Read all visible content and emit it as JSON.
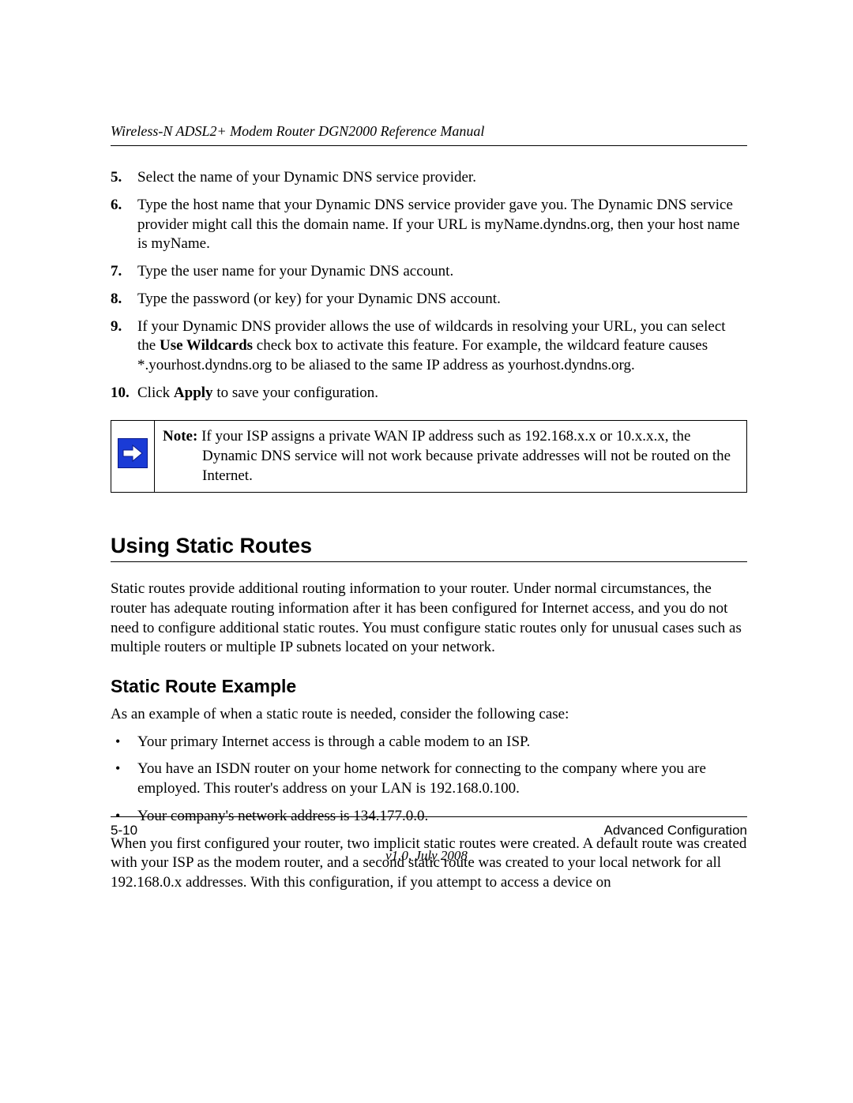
{
  "header": {
    "running_title": "Wireless-N ADSL2+ Modem Router DGN2000 Reference Manual"
  },
  "steps": {
    "s5": "Select the name of your Dynamic DNS service provider.",
    "s6": "Type the host name that your Dynamic DNS service provider gave you. The Dynamic DNS service provider might call this the domain name. If your URL is myName.dyndns.org, then your host name is myName.",
    "s7": "Type the user name for your Dynamic DNS account.",
    "s8": "Type the password (or key) for your Dynamic DNS account.",
    "s9_a": "If your Dynamic DNS provider allows the use of wildcards in resolving your URL, you can select the ",
    "s9_bold": "Use Wildcards",
    "s9_b": " check box to activate this feature. For example, the wildcard feature causes *.yourhost.dyndns.org to be aliased to the same IP address as yourhost.dyndns.org.",
    "s10_a": "Click ",
    "s10_bold": "Apply",
    "s10_b": " to save your configuration."
  },
  "note": {
    "label": "Note:",
    "text": " If your ISP assigns a private WAN IP address such as 192.168.x.x or 10.x.x.x, the Dynamic DNS service will not work because private addresses will not be routed on the Internet."
  },
  "section": {
    "title": "Using Static Routes",
    "body": "Static routes provide additional routing information to your router. Under normal circumstances, the router has adequate routing information after it has been configured for Internet access, and you do not need to configure additional static routes. You must configure static routes only for unusual cases such as multiple routers or multiple IP subnets located on your network."
  },
  "subsection": {
    "title": "Static Route Example",
    "intro": "As an example of when a static route is needed, consider the following case:",
    "bullets": {
      "b1": "Your primary Internet access is through a cable modem to an ISP.",
      "b2": "You have an ISDN router on your home network for connecting to the company where you are employed. This router's address on your LAN is 192.168.0.100.",
      "b3": "Your company's network address is 134.177.0.0."
    },
    "closing": "When you first configured your router, two implicit static routes were created. A default route was created with your ISP as the modem router, and a second static route was created to your local network for all 192.168.0.x addresses. With this configuration, if you attempt to access a device on"
  },
  "footer": {
    "page_num": "5-10",
    "chapter": "Advanced Configuration",
    "version": "v1.0, July 2008"
  }
}
